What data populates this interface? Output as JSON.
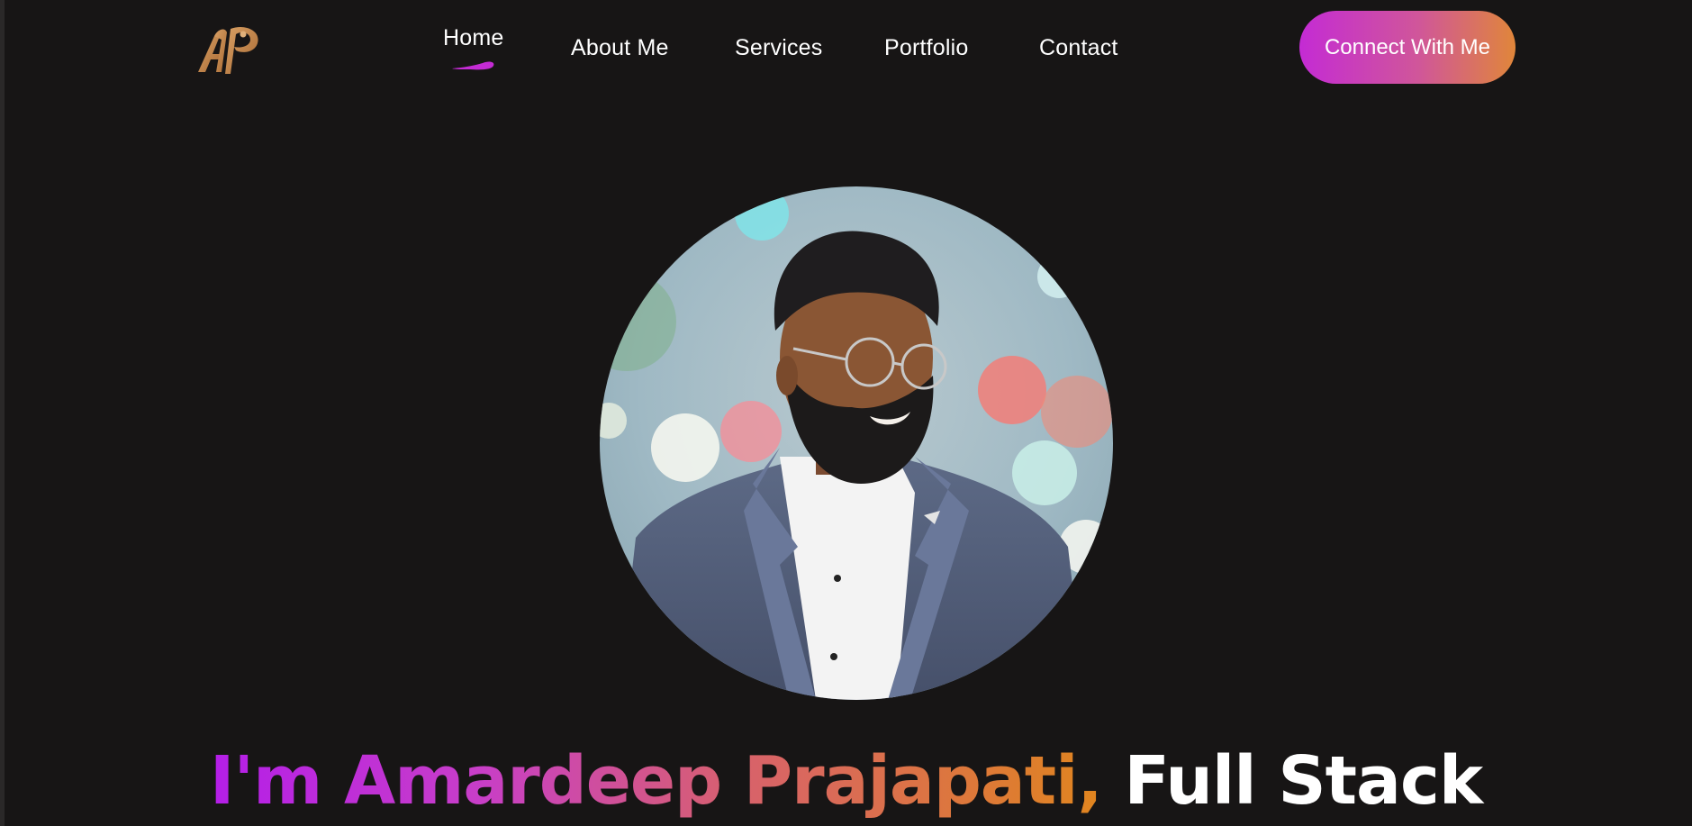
{
  "brand": {
    "logo_text": "AP",
    "logo_color": "#c88a4a"
  },
  "nav": {
    "items": [
      {
        "label": "Home",
        "active": true
      },
      {
        "label": "About Me",
        "active": false
      },
      {
        "label": "Services",
        "active": false
      },
      {
        "label": "Portfolio",
        "active": false
      },
      {
        "label": "Contact",
        "active": false
      }
    ],
    "active_indicator_color": "#c42bd4"
  },
  "cta": {
    "label": "Connect With Me"
  },
  "hero": {
    "avatar_icon": "profile-photo",
    "heading_gradient_part": "I'm Amardeep Prajapati,",
    "heading_white_part": " Full Stack"
  },
  "colors": {
    "background": "#171515",
    "gradient_start": "#b41ee8",
    "gradient_end": "#e0851e",
    "text": "#ffffff"
  }
}
